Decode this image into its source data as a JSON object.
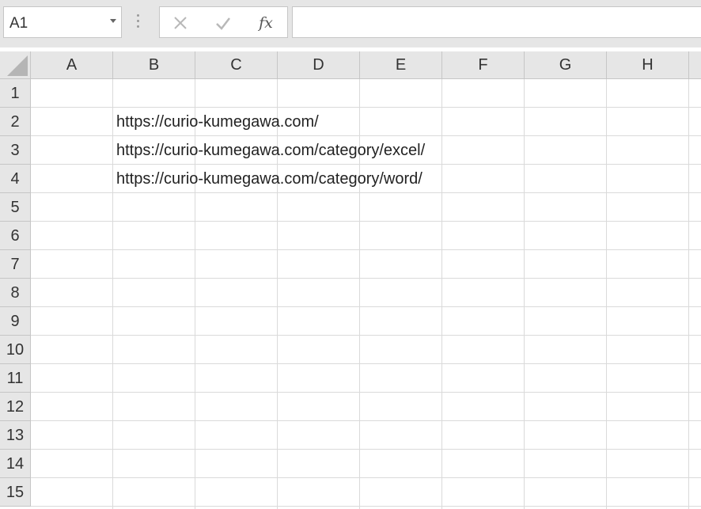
{
  "name_box": {
    "value": "A1",
    "dropdown_icon": "chevron-down-icon"
  },
  "formula_bar": {
    "cancel_icon": "close-icon",
    "enter_icon": "check-icon",
    "insert_function_label": "fx",
    "formula_value": ""
  },
  "columns": [
    "A",
    "B",
    "C",
    "D",
    "E",
    "F",
    "G",
    "H"
  ],
  "rows": [
    "1",
    "2",
    "3",
    "4",
    "5",
    "6",
    "7",
    "8",
    "9",
    "10",
    "11",
    "12",
    "13",
    "14",
    "15"
  ],
  "cells": {
    "B2": "https://curio-kumegawa.com/",
    "B3": "https://curio-kumegawa.com/category/excel/",
    "B4": "https://curio-kumegawa.com/category/word/"
  },
  "colors": {
    "header_bg": "#e6e6e6",
    "gridline": "#dadada"
  }
}
